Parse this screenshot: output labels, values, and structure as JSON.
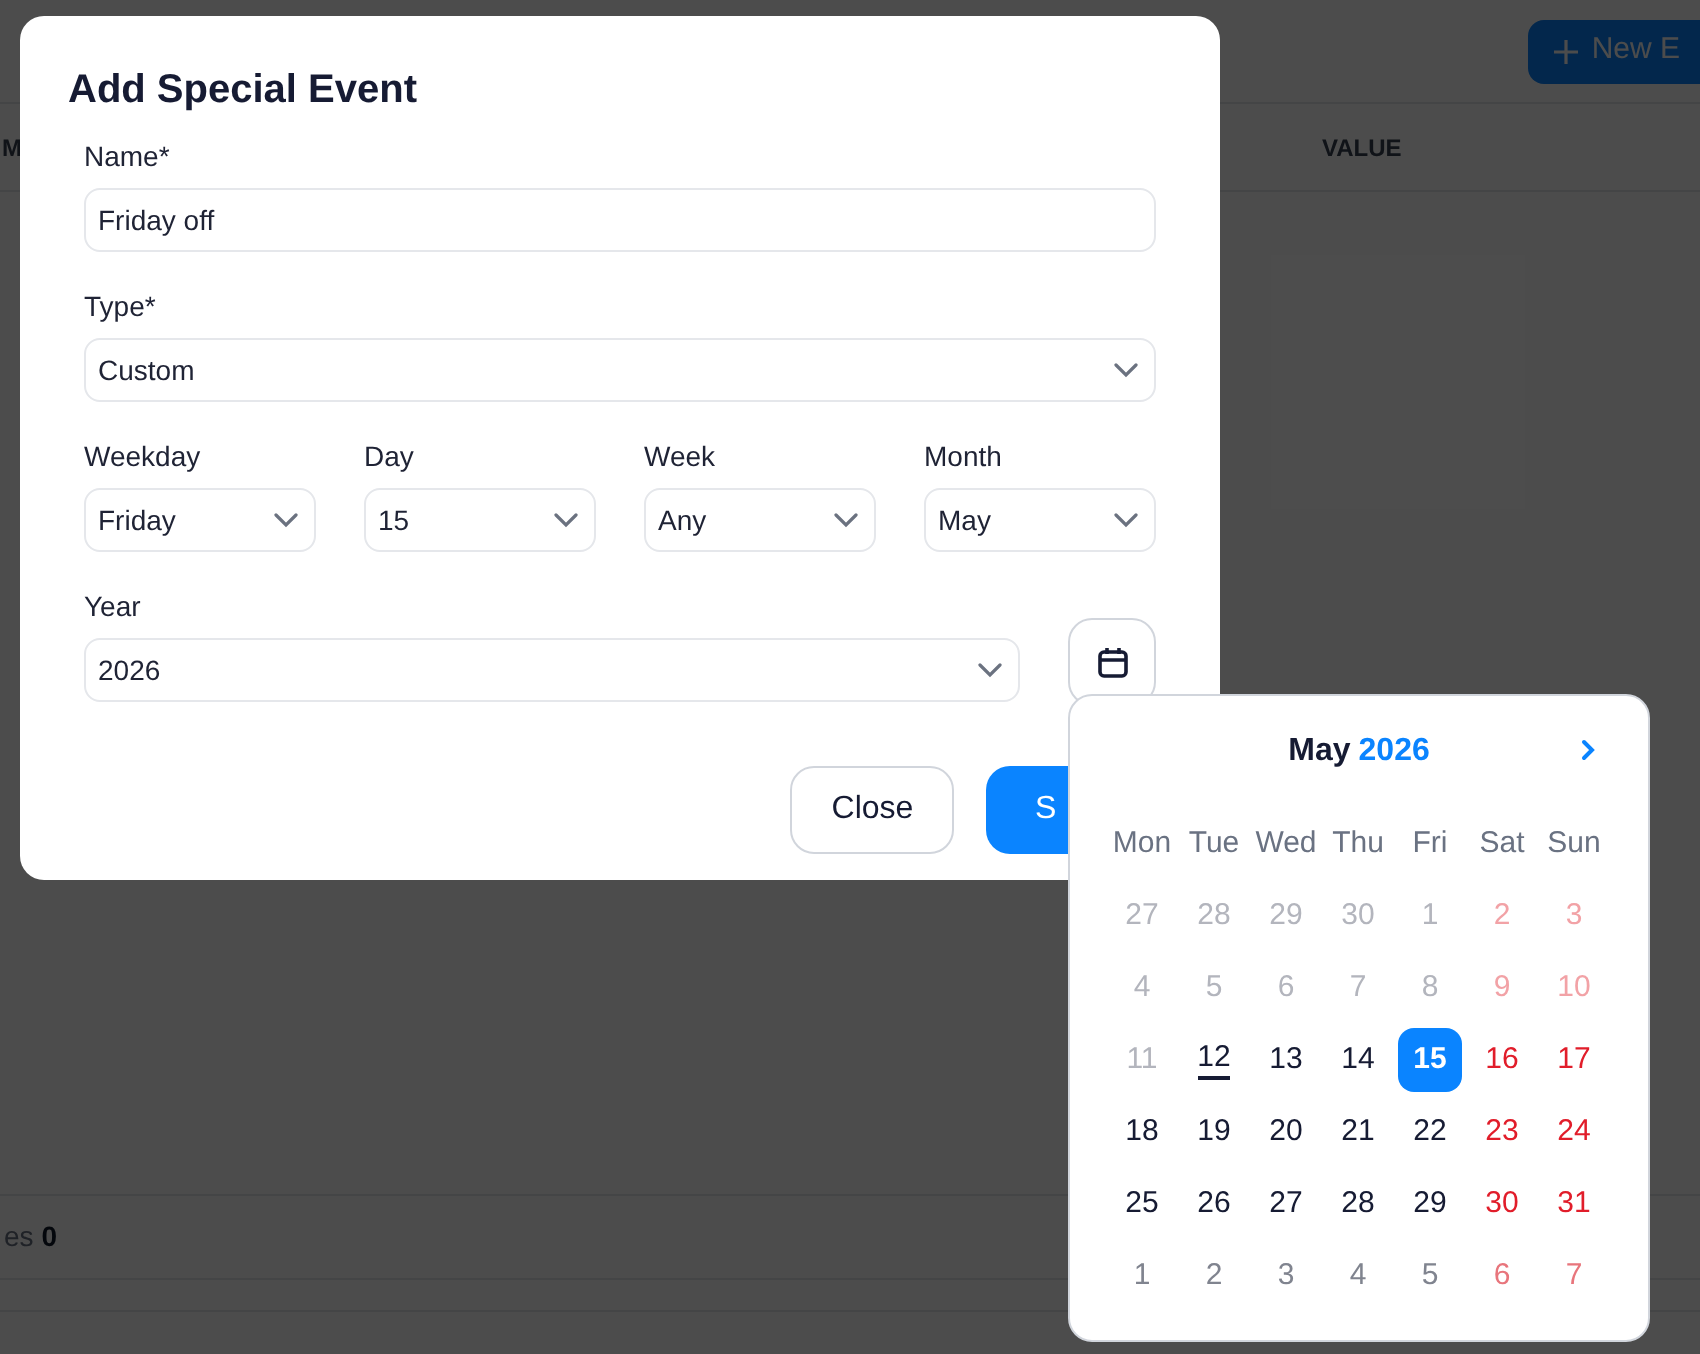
{
  "background": {
    "new_button": "New E",
    "columns": [
      "M",
      "VALUE"
    ],
    "footer_label": "es",
    "footer_count": "0"
  },
  "dialog": {
    "title": "Add Special Event",
    "name": {
      "label": "Name*",
      "value": "Friday off"
    },
    "type": {
      "label": "Type*",
      "value": "Custom"
    },
    "selects": [
      {
        "label": "Weekday",
        "value": "Friday"
      },
      {
        "label": "Day",
        "value": "15"
      },
      {
        "label": "Week",
        "value": "Any"
      },
      {
        "label": "Month",
        "value": "May"
      }
    ],
    "year": {
      "label": "Year",
      "value": "2026"
    },
    "buttons": [
      {
        "label": "Close",
        "kind": "secondary"
      },
      {
        "label": "S",
        "kind": "primary"
      }
    ]
  },
  "calendar": {
    "month": "May",
    "year": "2026",
    "weekdays": [
      "Mon",
      "Tue",
      "Wed",
      "Thu",
      "Fri",
      "Sat",
      "Sun"
    ],
    "weeks": [
      [
        {
          "label": "27",
          "kind": "past",
          "weekend": false,
          "today": false,
          "selected": false
        },
        {
          "label": "28",
          "kind": "past",
          "weekend": false,
          "today": false,
          "selected": false
        },
        {
          "label": "29",
          "kind": "past",
          "weekend": false,
          "today": false,
          "selected": false
        },
        {
          "label": "30",
          "kind": "past",
          "weekend": false,
          "today": false,
          "selected": false
        },
        {
          "label": "1",
          "kind": "past",
          "weekend": false,
          "today": false,
          "selected": false
        },
        {
          "label": "2",
          "kind": "past",
          "weekend": true,
          "today": false,
          "selected": false
        },
        {
          "label": "3",
          "kind": "past",
          "weekend": true,
          "today": false,
          "selected": false
        }
      ],
      [
        {
          "label": "4",
          "kind": "past",
          "weekend": false,
          "today": false,
          "selected": false
        },
        {
          "label": "5",
          "kind": "past",
          "weekend": false,
          "today": false,
          "selected": false
        },
        {
          "label": "6",
          "kind": "past",
          "weekend": false,
          "today": false,
          "selected": false
        },
        {
          "label": "7",
          "kind": "past",
          "weekend": false,
          "today": false,
          "selected": false
        },
        {
          "label": "8",
          "kind": "past",
          "weekend": false,
          "today": false,
          "selected": false
        },
        {
          "label": "9",
          "kind": "past",
          "weekend": true,
          "today": false,
          "selected": false
        },
        {
          "label": "10",
          "kind": "past",
          "weekend": true,
          "today": false,
          "selected": false
        }
      ],
      [
        {
          "label": "11",
          "kind": "past",
          "weekend": false,
          "today": false,
          "selected": false
        },
        {
          "label": "12",
          "kind": "current",
          "weekend": false,
          "today": true,
          "selected": false
        },
        {
          "label": "13",
          "kind": "current",
          "weekend": false,
          "today": false,
          "selected": false
        },
        {
          "label": "14",
          "kind": "current",
          "weekend": false,
          "today": false,
          "selected": false
        },
        {
          "label": "15",
          "kind": "current",
          "weekend": false,
          "today": false,
          "selected": true
        },
        {
          "label": "16",
          "kind": "current",
          "weekend": true,
          "today": false,
          "selected": false
        },
        {
          "label": "17",
          "kind": "current",
          "weekend": true,
          "today": false,
          "selected": false
        }
      ],
      [
        {
          "label": "18",
          "kind": "current",
          "weekend": false,
          "today": false,
          "selected": false
        },
        {
          "label": "19",
          "kind": "current",
          "weekend": false,
          "today": false,
          "selected": false
        },
        {
          "label": "20",
          "kind": "current",
          "weekend": false,
          "today": false,
          "selected": false
        },
        {
          "label": "21",
          "kind": "current",
          "weekend": false,
          "today": false,
          "selected": false
        },
        {
          "label": "22",
          "kind": "current",
          "weekend": false,
          "today": false,
          "selected": false
        },
        {
          "label": "23",
          "kind": "current",
          "weekend": true,
          "today": false,
          "selected": false
        },
        {
          "label": "24",
          "kind": "current",
          "weekend": true,
          "today": false,
          "selected": false
        }
      ],
      [
        {
          "label": "25",
          "kind": "current",
          "weekend": false,
          "today": false,
          "selected": false
        },
        {
          "label": "26",
          "kind": "current",
          "weekend": false,
          "today": false,
          "selected": false
        },
        {
          "label": "27",
          "kind": "current",
          "weekend": false,
          "today": false,
          "selected": false
        },
        {
          "label": "28",
          "kind": "current",
          "weekend": false,
          "today": false,
          "selected": false
        },
        {
          "label": "29",
          "kind": "current",
          "weekend": false,
          "today": false,
          "selected": false
        },
        {
          "label": "30",
          "kind": "current",
          "weekend": true,
          "today": false,
          "selected": false
        },
        {
          "label": "31",
          "kind": "current",
          "weekend": true,
          "today": false,
          "selected": false
        }
      ],
      [
        {
          "label": "1",
          "kind": "next",
          "weekend": false,
          "today": false,
          "selected": false
        },
        {
          "label": "2",
          "kind": "next",
          "weekend": false,
          "today": false,
          "selected": false
        },
        {
          "label": "3",
          "kind": "next",
          "weekend": false,
          "today": false,
          "selected": false
        },
        {
          "label": "4",
          "kind": "next",
          "weekend": false,
          "today": false,
          "selected": false
        },
        {
          "label": "5",
          "kind": "next",
          "weekend": false,
          "today": false,
          "selected": false
        },
        {
          "label": "6",
          "kind": "next",
          "weekend": true,
          "today": false,
          "selected": false
        },
        {
          "label": "7",
          "kind": "next",
          "weekend": true,
          "today": false,
          "selected": false
        }
      ]
    ]
  }
}
